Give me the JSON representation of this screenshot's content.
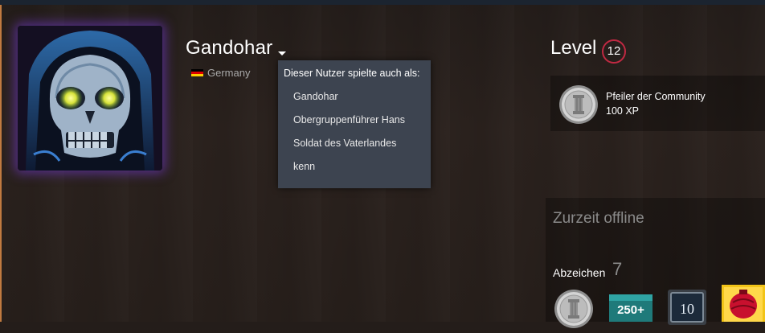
{
  "profile": {
    "persona_name": "Gandohar",
    "country": "Germany",
    "flag_colors": [
      "#000000",
      "#dd0000",
      "#ffce00"
    ]
  },
  "alias_popup": {
    "title": "Dieser Nutzer spielte auch als:",
    "items": [
      "Gandohar",
      "Obergruppenführer Hans",
      "Soldat des Vaterlandes",
      "kenn"
    ]
  },
  "level": {
    "label": "Level",
    "value": "12",
    "ring_color": "#c02942"
  },
  "featured_badge": {
    "name": "Pfeiler der Community",
    "xp": "100 XP",
    "icon": "pillar-coin-icon"
  },
  "status": {
    "text": "Zurzeit offline"
  },
  "badges": {
    "label": "Abzeichen",
    "count": "7",
    "thumbnails": [
      {
        "icon": "pillar-coin-icon",
        "text": ""
      },
      {
        "icon": "years-badge-icon",
        "text": "250+"
      },
      {
        "icon": "game-badge-icon",
        "text": "10"
      },
      {
        "icon": "lantern-badge-icon",
        "text": ""
      }
    ]
  },
  "colors": {
    "background": "#2a211d",
    "popup": "#3d4450",
    "avatar_glow": "#7a3cdc"
  }
}
